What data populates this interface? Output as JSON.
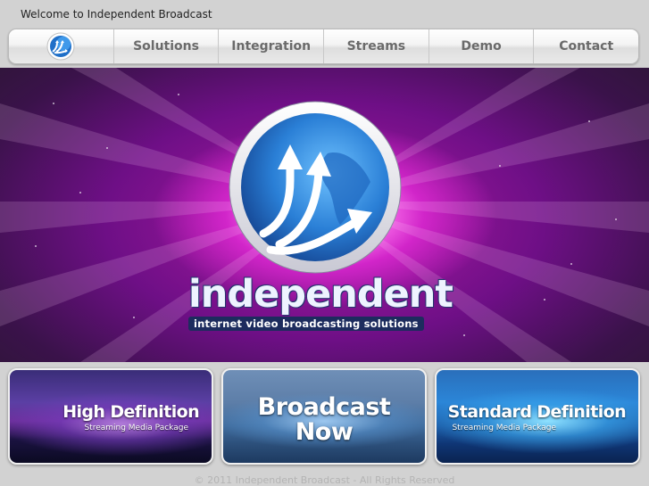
{
  "header": {
    "welcome": "Welcome to Independent Broadcast"
  },
  "nav": {
    "logo_icon": "globe-arrows-icon",
    "items": [
      {
        "label": "Solutions"
      },
      {
        "label": "Integration"
      },
      {
        "label": "Streams"
      },
      {
        "label": "Demo"
      },
      {
        "label": "Contact"
      }
    ]
  },
  "hero": {
    "logo_icon": "globe-arrows-icon",
    "wordmark": "independent",
    "tagline": "internet video broadcasting solutions"
  },
  "cards": {
    "hd": {
      "title": "High Definition",
      "subtitle": "Streaming Media Package"
    },
    "broadcast": {
      "line1": "Broadcast",
      "line2": "Now"
    },
    "sd": {
      "title": "Standard Definition",
      "subtitle": "Streaming Media Package"
    }
  },
  "footer": {
    "copyright": "© 2011 Independent Broadcast - All Rights Reserved"
  },
  "colors": {
    "accent_magenta": "#d233c8",
    "globe_blue": "#2a7fd6",
    "nav_text": "#6a6a6a"
  }
}
